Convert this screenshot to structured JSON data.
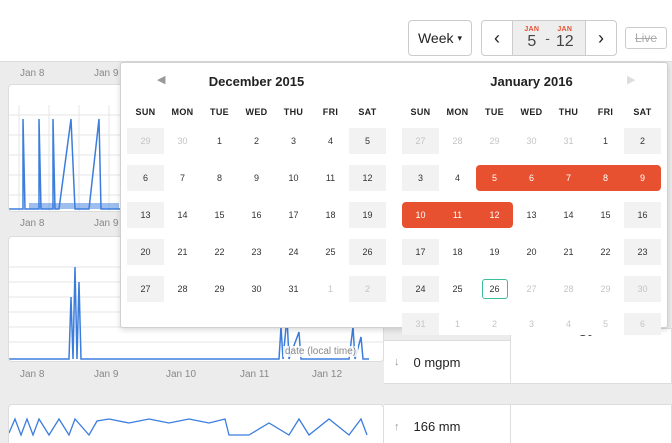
{
  "toolbar": {
    "period_select": "Week",
    "caret": "▾",
    "prev_icon": "‹",
    "next_icon": "›",
    "range_start_month": "JAN",
    "range_start_day": "5",
    "range_separator": "-",
    "range_end_month": "JAN",
    "range_end_day": "12",
    "live_label": "Live"
  },
  "chart1": {
    "axis_labels": [
      "Jan 8",
      "Jan 9"
    ]
  },
  "chart2": {
    "axis_labels": [
      "Jan 8",
      "Jan 9"
    ]
  },
  "chart3": {
    "axis_labels": [
      "Jan 8",
      "Jan 9",
      "Jan 10",
      "Jan 11",
      "Jan 12"
    ],
    "x_axis_label": "date (local time)"
  },
  "metrics": [
    {
      "arrow": "↓",
      "value": "0 mgpm"
    },
    {
      "arrow": "↑",
      "value": "166 mm"
    }
  ],
  "calendar": {
    "weekday_headers": [
      "SUN",
      "MON",
      "TUE",
      "WED",
      "THU",
      "FRI",
      "SAT"
    ],
    "left": {
      "title": "December 2015",
      "prev_icon": "◀",
      "weeks": [
        [
          "29",
          "30",
          "1",
          "2",
          "3",
          "4",
          "5"
        ],
        [
          "6",
          "7",
          "8",
          "9",
          "10",
          "11",
          "12"
        ],
        [
          "13",
          "14",
          "15",
          "16",
          "17",
          "18",
          "19"
        ],
        [
          "20",
          "21",
          "22",
          "23",
          "24",
          "25",
          "26"
        ],
        [
          "27",
          "28",
          "29",
          "30",
          "31",
          "1",
          "2"
        ]
      ]
    },
    "right": {
      "title": "January 2016",
      "next_icon": "▶",
      "weeks": [
        [
          "27",
          "28",
          "29",
          "30",
          "31",
          "1",
          "2"
        ],
        [
          "3",
          "4",
          "5",
          "6",
          "7",
          "8",
          "9"
        ],
        [
          "10",
          "11",
          "12",
          "13",
          "14",
          "15",
          "16"
        ],
        [
          "17",
          "18",
          "19",
          "20",
          "21",
          "22",
          "23"
        ],
        [
          "24",
          "25",
          "26",
          "27",
          "28",
          "29",
          "30"
        ],
        [
          "31",
          "1",
          "2",
          "3",
          "4",
          "5",
          "6"
        ]
      ]
    }
  },
  "colors": {
    "accent": "#e8512f",
    "today_outline": "#3bbf9a",
    "chart_line": "#3b7ddd"
  },
  "snippet_glyph": "gy"
}
